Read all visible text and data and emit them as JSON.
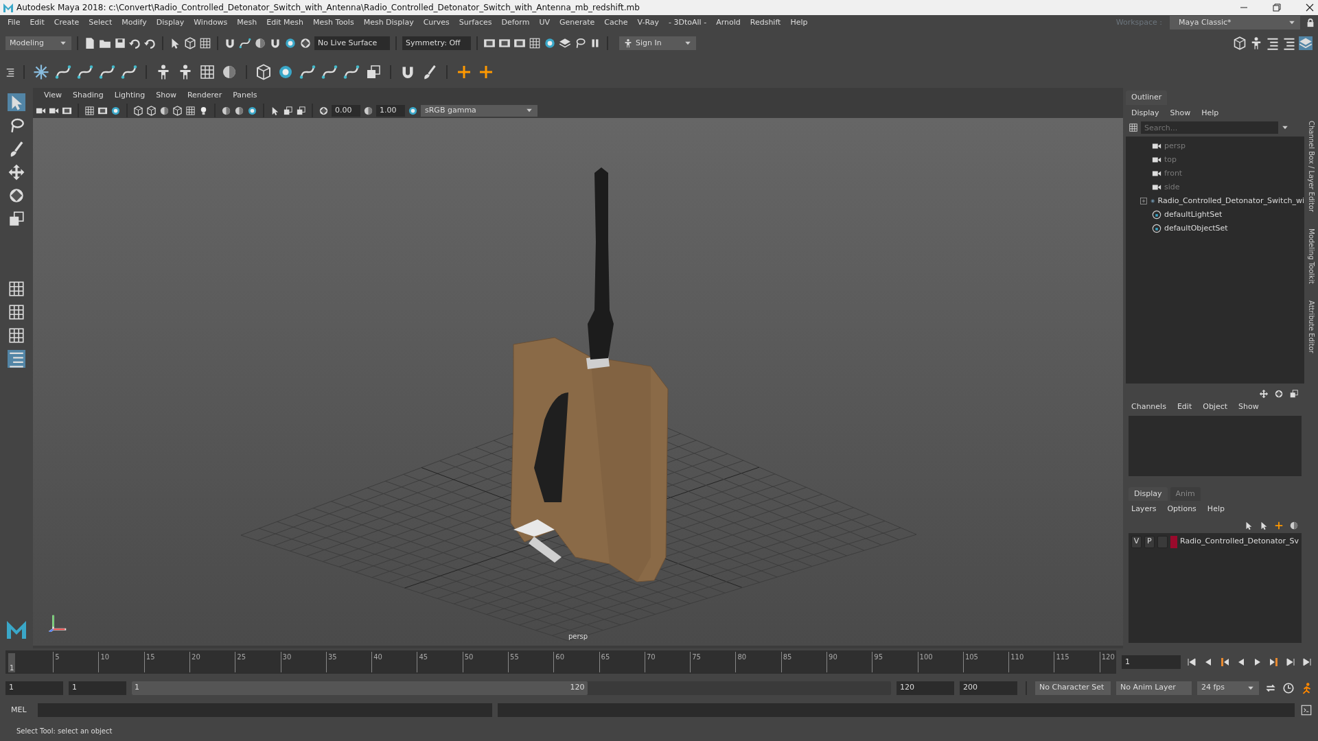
{
  "window": {
    "title": "Autodesk Maya 2018: c:\\Convert\\Radio_Controlled_Detonator_Switch_with_Antenna\\Radio_Controlled_Detonator_Switch_with_Antenna_mb_redshift.mb"
  },
  "menu_bar": [
    "File",
    "Edit",
    "Create",
    "Select",
    "Modify",
    "Display",
    "Windows",
    "Mesh",
    "Edit Mesh",
    "Mesh Tools",
    "Mesh Display",
    "Curves",
    "Surfaces",
    "Deform",
    "UV",
    "Generate",
    "Cache",
    "V-Ray",
    "- 3DtoAll -",
    "Arnold",
    "Redshift",
    "Help"
  ],
  "status_line": {
    "mode": "Modeling",
    "live_surface": "No Live Surface",
    "symmetry": "Symmetry: Off",
    "sign_in": "Sign In",
    "workspace_label": "Workspace :",
    "workspace": "Maya Classic*"
  },
  "toolbox": {
    "tools": [
      {
        "selected": true
      },
      {
        "selected": false
      },
      {
        "selected": false
      },
      {
        "selected": false
      },
      {
        "selected": false
      },
      {
        "selected": false
      }
    ],
    "layouts": [
      {
        "selected": false
      },
      {
        "selected": false
      },
      {
        "selected": false
      },
      {
        "selected": true
      }
    ]
  },
  "viewport": {
    "menu": [
      "View",
      "Shading",
      "Lighting",
      "Show",
      "Renderer",
      "Panels"
    ],
    "exposure": "0.00",
    "gamma": "1.00",
    "color_space": "sRGB gamma",
    "camera_label": "persp"
  },
  "outliner": {
    "title": "Outliner",
    "menu": [
      "Display",
      "Show",
      "Help"
    ],
    "search": {
      "placeholder": "Search..."
    },
    "items": [
      {
        "kind": "camera",
        "label": "persp",
        "dimmed": true
      },
      {
        "kind": "camera",
        "label": "top",
        "dimmed": true
      },
      {
        "kind": "camera",
        "label": "front",
        "dimmed": true
      },
      {
        "kind": "camera",
        "label": "side",
        "dimmed": true
      },
      {
        "kind": "group",
        "label": "Radio_Controlled_Detonator_Switch_wi",
        "dimmed": false
      },
      {
        "kind": "set",
        "label": "defaultLightSet",
        "dimmed": false
      },
      {
        "kind": "set",
        "label": "defaultObjectSet",
        "dimmed": false
      }
    ]
  },
  "channel_box": {
    "menu": [
      "Channels",
      "Edit",
      "Object",
      "Show"
    ]
  },
  "layer_editor": {
    "tabs": [
      {
        "label": "Display",
        "selected": true
      },
      {
        "label": "Anim",
        "selected": false
      }
    ],
    "menu": [
      "Layers",
      "Options",
      "Help"
    ],
    "layers": [
      {
        "visible": "V",
        "playback": "P",
        "color": "#9a0a2c",
        "name": "Radio_Controlled_Detonator_Sv"
      }
    ]
  },
  "side_tabs": [
    "Channel Box / Layer Editor",
    "Modeling Toolkit",
    "Attribute Editor"
  ],
  "timeline": {
    "current_marker": "1",
    "ticks": [
      "5",
      "10",
      "15",
      "20",
      "25",
      "30",
      "35",
      "40",
      "45",
      "50",
      "55",
      "60",
      "65",
      "70",
      "75",
      "80",
      "85",
      "90",
      "95",
      "100",
      "105",
      "110",
      "115",
      "120"
    ],
    "current_frame": "1",
    "level": 0
  },
  "range": {
    "start": "1",
    "anim_start": "1",
    "slider_start": "1",
    "slider_end": "120",
    "level": 0.6,
    "end": "120",
    "anim_end": "200",
    "character_set": "No Character Set",
    "anim_layer": "No Anim Layer",
    "fps": "24 fps"
  },
  "command_line": {
    "language": "MEL"
  },
  "help_line": "Select Tool: select an object"
}
